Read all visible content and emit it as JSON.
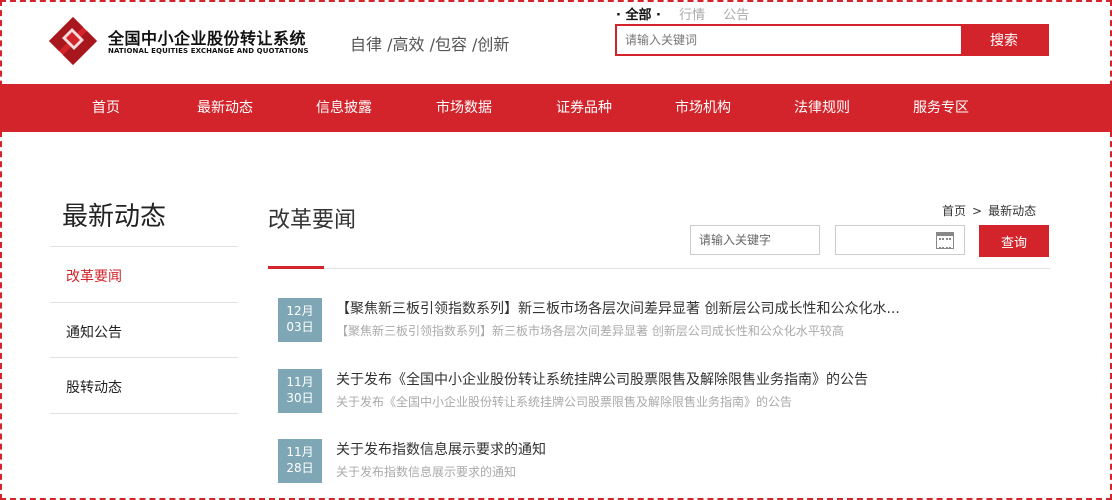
{
  "header": {
    "logo_cn": "全国中小企业股份转让系统",
    "logo_en": "NATIONAL EQUITIES EXCHANGE AND QUOTATIONS",
    "slogan": "自律 /高效 /包容 /创新",
    "scope_tabs": [
      {
        "label": "· 全部 ·",
        "active": true
      },
      {
        "label": "行情",
        "active": false
      },
      {
        "label": "公告",
        "active": false
      }
    ],
    "search_placeholder": "请输入关键词",
    "search_button": "搜索"
  },
  "nav": {
    "items": [
      "首页",
      "最新动态",
      "信息披露",
      "市场数据",
      "证券品种",
      "市场机构",
      "法律规则",
      "服务专区"
    ]
  },
  "sidebar": {
    "title": "最新动态",
    "items": [
      {
        "label": "改革要闻",
        "active": true
      },
      {
        "label": "通知公告",
        "active": false
      },
      {
        "label": "股转动态",
        "active": false
      }
    ]
  },
  "main": {
    "title": "改革要闻",
    "breadcrumb": [
      "首页",
      ">",
      "最新动态"
    ],
    "keyword_placeholder": "请输入关键字",
    "query_button": "查询",
    "news": [
      {
        "month": "12月",
        "day": "03日",
        "title": "【聚焦新三板引领指数系列】新三板市场各层次间差异显著 创新层公司成长性和公众化水...",
        "summary": "【聚焦新三板引领指数系列】新三板市场各层次间差异显著 创新层公司成长性和公众化水平较高"
      },
      {
        "month": "11月",
        "day": "30日",
        "title": "关于发布《全国中小企业股份转让系统挂牌公司股票限售及解除限售业务指南》的公告",
        "summary": "关于发布《全国中小企业股份转让系统挂牌公司股票限售及解除限售业务指南》的公告"
      },
      {
        "month": "11月",
        "day": "28日",
        "title": "关于发布指数信息展示要求的通知",
        "summary": "关于发布指数信息展示要求的通知"
      }
    ]
  },
  "colors": {
    "brand_red": "#d3242b",
    "date_box": "#7ea6b4"
  }
}
